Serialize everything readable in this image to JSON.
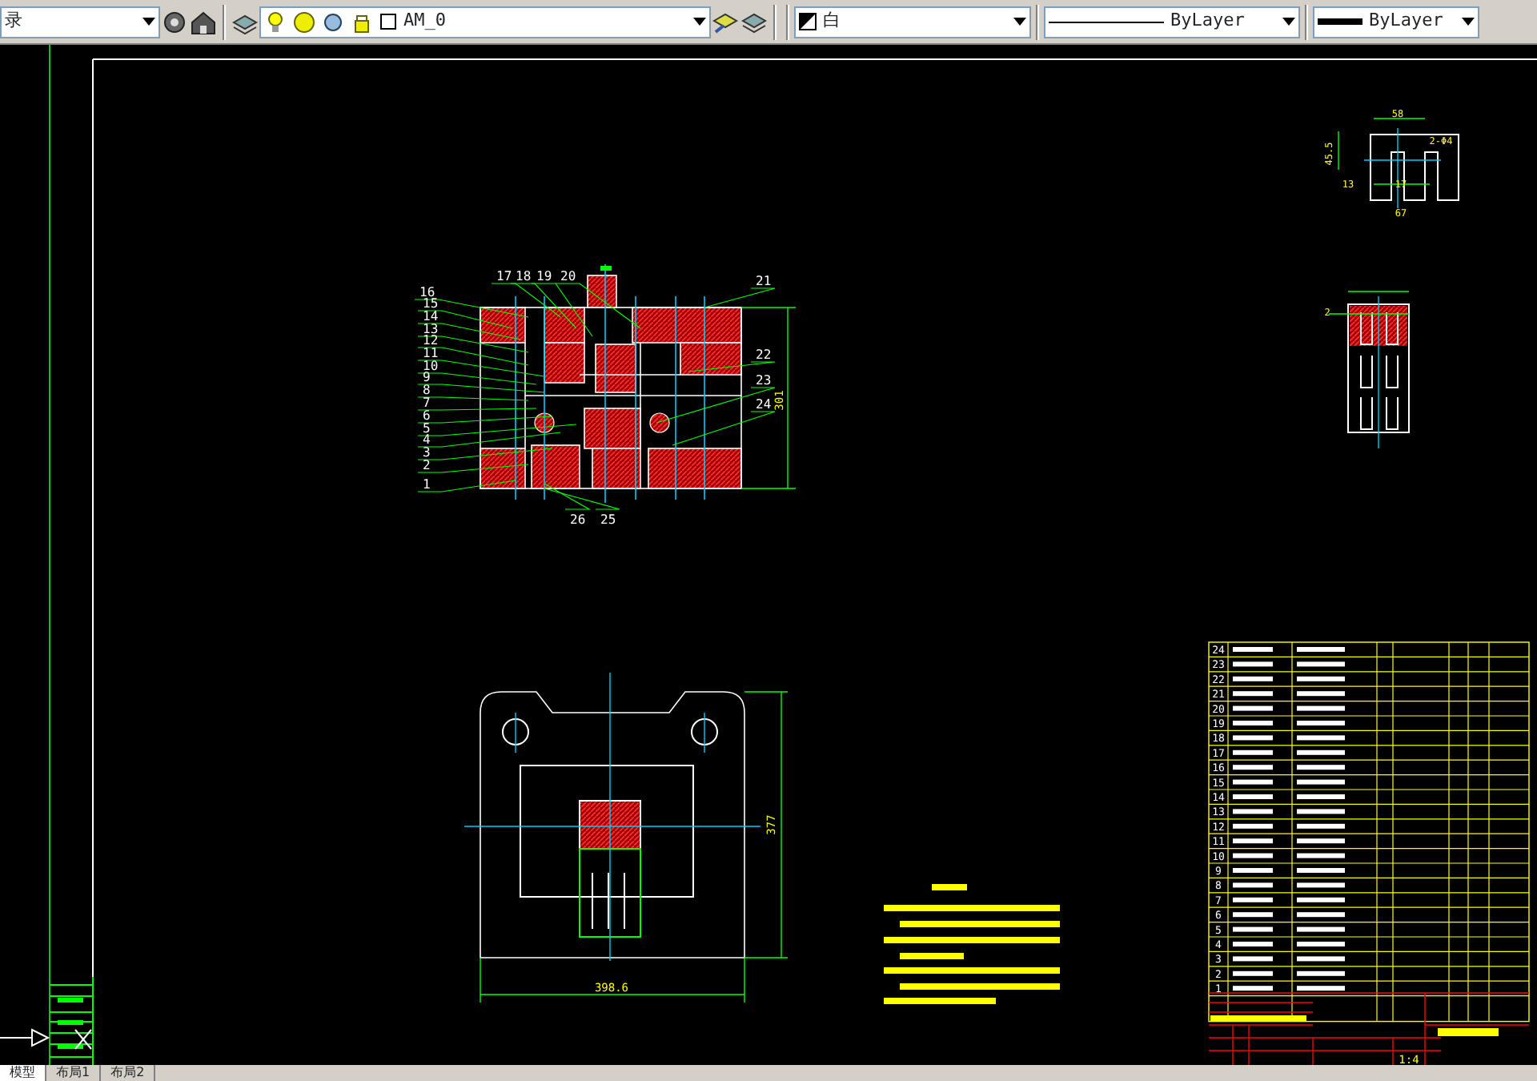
{
  "toolbar": {
    "left_dropdown": {
      "value": "录"
    },
    "layer_dropdown": {
      "value": "AM_0"
    },
    "color_dropdown": {
      "value": "白"
    },
    "linetype_dropdown": {
      "value": "ByLayer"
    },
    "lineweight_dropdown": {
      "value": "ByLayer"
    }
  },
  "drawing": {
    "section_balloons": [
      "16",
      "15",
      "14",
      "13",
      "12",
      "11",
      "10",
      "9",
      "8",
      "7",
      "6",
      "5",
      "4",
      "3",
      "2",
      "1",
      "17",
      "18",
      "19",
      "20",
      "21",
      "22",
      "23",
      "24",
      "26",
      "25"
    ],
    "section_dimension": "301",
    "plan_dimensions": [
      "377",
      "398.6"
    ],
    "detail_dimensions": [
      "58",
      "45.5",
      "13",
      "17",
      "67",
      "2-Φ4",
      "2"
    ],
    "bom_rows": [
      "24",
      "23",
      "22",
      "21",
      "20",
      "19",
      "18",
      "17",
      "16",
      "15",
      "14",
      "13",
      "12",
      "11",
      "10",
      "9",
      "8",
      "7",
      "6",
      "5",
      "4",
      "3",
      "2",
      "1"
    ],
    "scale": "1:4"
  },
  "layout_tabs": [
    {
      "label": "模型",
      "selected": true
    },
    {
      "label": "布局1",
      "selected": false
    },
    {
      "label": "布局2",
      "selected": false
    }
  ]
}
